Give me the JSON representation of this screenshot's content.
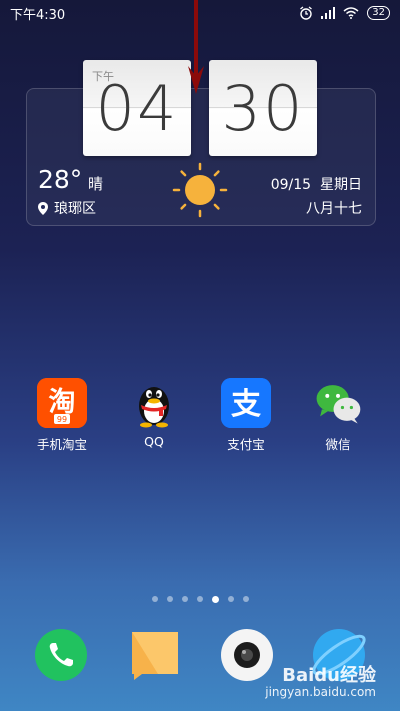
{
  "status_bar": {
    "time": "下午4:30",
    "battery": "32",
    "icons": [
      "alarm-icon",
      "signal-icon",
      "wifi-icon",
      "battery-icon"
    ]
  },
  "clock_widget": {
    "ampm": "下午",
    "hour": "04",
    "minute": "30"
  },
  "weather": {
    "temperature": "28°",
    "condition": "晴",
    "location": "琅琊区",
    "date": "09/15",
    "weekday": "星期日",
    "lunar_date": "八月十七",
    "icon": "sun-icon"
  },
  "apps": [
    {
      "label": "手机淘宝",
      "icon": "taobao-icon"
    },
    {
      "label": "QQ",
      "icon": "qq-icon"
    },
    {
      "label": "支付宝",
      "icon": "alipay-icon"
    },
    {
      "label": "微信",
      "icon": "wechat-icon"
    }
  ],
  "page_indicator": {
    "count": 7,
    "active_index": 4
  },
  "dock": [
    "phone-icon",
    "messages-icon",
    "camera-icon",
    "browser-icon"
  ],
  "watermark": {
    "line1": "Baidu经验",
    "line2": "jingyan.baidu.com"
  },
  "colors": {
    "taobao": "#ff5000",
    "alipay": "#1677ff",
    "wechat": "#3fb83f",
    "phone": "#21c25f",
    "arrow": "#8b0a0a"
  }
}
